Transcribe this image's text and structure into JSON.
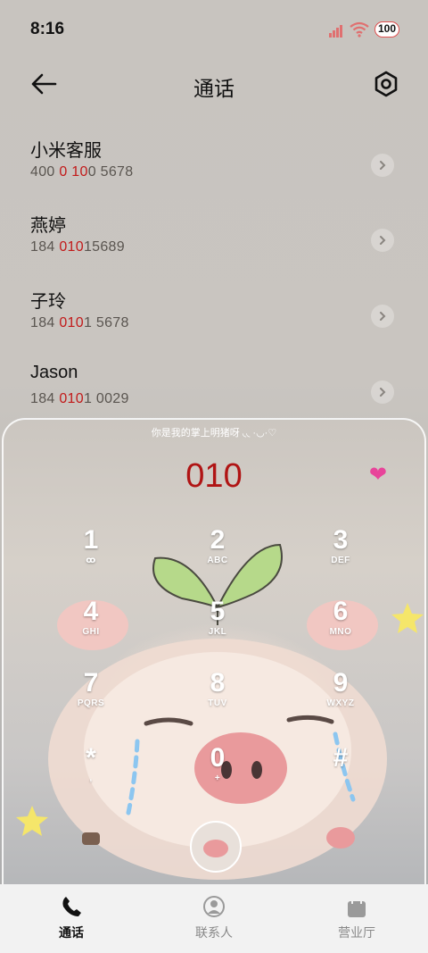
{
  "status_bar": {
    "time": "8:16",
    "battery": "100",
    "accent": "#e05050"
  },
  "header": {
    "title": "通话",
    "back_icon": "arrow-left-icon",
    "settings_icon": "gear-icon"
  },
  "matches": [
    {
      "name": "小米客服",
      "num_pre": "400 ",
      "num_hl": "0 10",
      "num_post": "0 5678"
    },
    {
      "name": "燕婷",
      "num_pre": "184 ",
      "num_hl": "010",
      "num_post": "15689"
    },
    {
      "name": "子玲",
      "num_pre": "184 ",
      "num_hl": "010",
      "num_post": "1 5678"
    },
    {
      "name": "Jason",
      "num_pre": "184 ",
      "num_hl": "010",
      "num_post": "1 0029"
    }
  ],
  "dialer": {
    "motto": "你是我的掌上明猪呀 ◟◟ ·◡·♡",
    "input": "010",
    "heart_icon": "heart-icon",
    "keys": [
      {
        "digit": "1",
        "letters": "ꝏ"
      },
      {
        "digit": "2",
        "letters": "ABC"
      },
      {
        "digit": "3",
        "letters": "DEF"
      },
      {
        "digit": "4",
        "letters": "GHI"
      },
      {
        "digit": "5",
        "letters": "JKL"
      },
      {
        "digit": "6",
        "letters": "MNO"
      },
      {
        "digit": "7",
        "letters": "PQRS"
      },
      {
        "digit": "8",
        "letters": "TUV"
      },
      {
        "digit": "9",
        "letters": "WXYZ"
      },
      {
        "digit": "*",
        "letters": ","
      },
      {
        "digit": "0",
        "letters": "+"
      },
      {
        "digit": "#",
        "letters": ""
      }
    ]
  },
  "nav": [
    {
      "label": "通话",
      "icon": "phone-icon",
      "active": true
    },
    {
      "label": "联系人",
      "icon": "person-icon",
      "active": false
    },
    {
      "label": "营业厅",
      "icon": "bag-icon",
      "active": false
    }
  ],
  "colors": {
    "highlight": "#c21a1a",
    "dial_digits": "#b01414"
  }
}
